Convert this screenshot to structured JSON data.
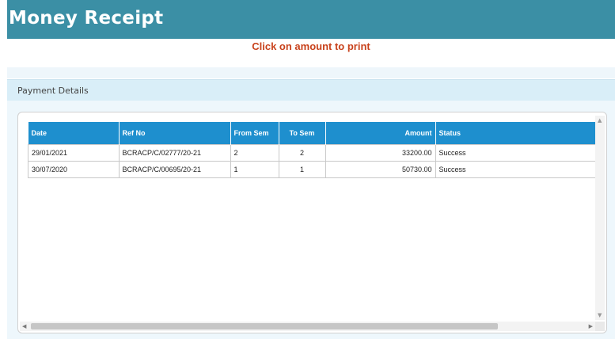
{
  "header": {
    "title": "Money Receipt"
  },
  "hint": "Click on amount to print",
  "panel": {
    "title": "Payment Details"
  },
  "table": {
    "columns": [
      "Date",
      "Ref No",
      "From Sem",
      "To Sem",
      "Amount",
      "Status"
    ],
    "rows": [
      [
        "29/01/2021",
        "BCRACP/C/02777/20-21",
        "2",
        "2",
        "33200.00",
        "Success"
      ],
      [
        "30/07/2020",
        "BCRACP/C/00695/20-21",
        "1",
        "1",
        "50730.00",
        "Success"
      ]
    ]
  },
  "icons": {
    "scroll_up": "triangle-up-icon",
    "scroll_down": "triangle-down-icon",
    "scroll_left": "triangle-left-icon",
    "scroll_right": "triangle-right-icon"
  },
  "colors": {
    "header_bg": "#3b8fa5",
    "hint_text": "#c8421c",
    "table_header_bg": "#1e8fce",
    "panel_head_bg": "#d9eef8"
  }
}
